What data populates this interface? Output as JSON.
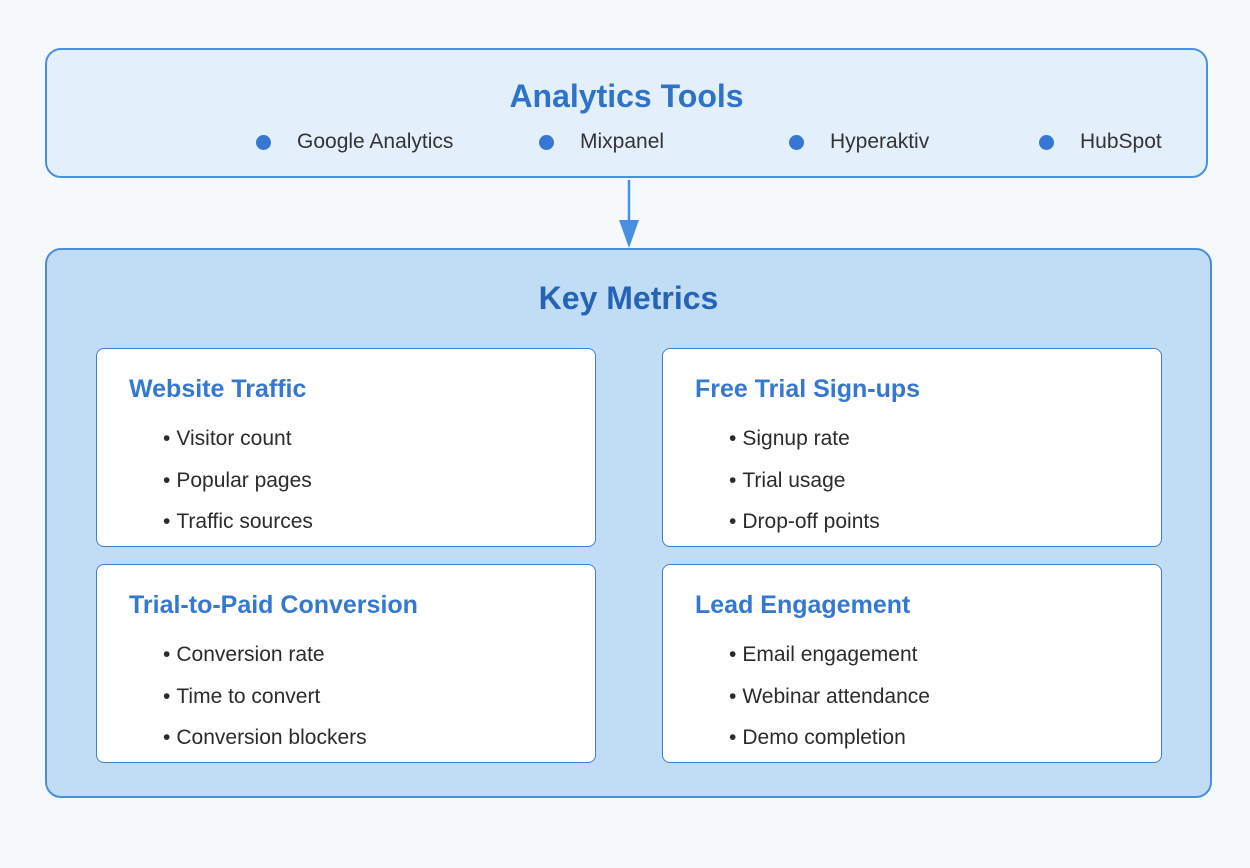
{
  "analytics_tools": {
    "title": "Analytics Tools",
    "items": [
      "Google Analytics",
      "Mixpanel",
      "Hyperaktiv",
      "HubSpot"
    ]
  },
  "key_metrics": {
    "title": "Key Metrics",
    "cards": [
      {
        "title": "Website Traffic",
        "items": [
          "Visitor count",
          "Popular pages",
          "Traffic sources"
        ]
      },
      {
        "title": "Free Trial Sign-ups",
        "items": [
          "Signup rate",
          "Trial usage",
          "Drop-off points"
        ]
      },
      {
        "title": "Trial-to-Paid Conversion",
        "items": [
          "Conversion rate",
          "Time to convert",
          "Conversion blockers"
        ]
      },
      {
        "title": "Lead Engagement",
        "items": [
          "Email engagement",
          "Webinar attendance",
          "Demo completion"
        ]
      }
    ]
  },
  "bullet_glyph": "•",
  "colors": {
    "accent": "#4a90e2",
    "title_blue": "#2f72c9",
    "tools_bg": "#e3f0fb",
    "metrics_bg": "#c0ddf5",
    "dot": "#3677d4"
  }
}
